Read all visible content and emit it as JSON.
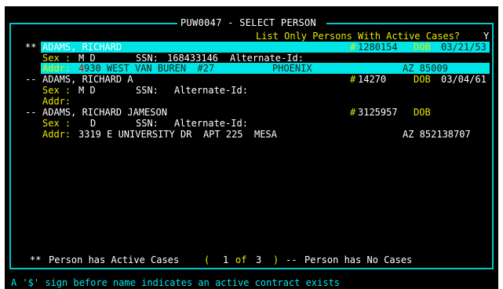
{
  "window": {
    "title": "PUW0047 - SELECT PERSON"
  },
  "filter": {
    "label": "List Only Persons With Active Cases?",
    "value": "Y"
  },
  "persons": [
    {
      "marker": "**",
      "name": "ADAMS, RICHARD",
      "id_prefix": "#",
      "id": "1280154",
      "dob_label": "DOB",
      "dob": "03/21/53",
      "sex_label": "Sex :",
      "sex": "M D",
      "ssn_label": "SSN:",
      "ssn": "168433146",
      "alt_id_label": "Alternate-Id:",
      "addr_label": "Addr:",
      "addr_mark": "4",
      "addr_street": "930 WEST VAN BUREN  #27",
      "addr_city": "PHOENIX",
      "addr_state_zip": "AZ 85009"
    },
    {
      "marker": "--",
      "name": "ADAMS, RICHARD A",
      "id_prefix": "#",
      "id": "14270",
      "dob_label": "DOB",
      "dob": "03/04/61",
      "sex_label": "Sex :",
      "sex": "M D",
      "ssn_label": "SSN:",
      "alt_id_label": "Alternate-Id:",
      "addr_label": "Addr:"
    },
    {
      "marker": "--",
      "name": "ADAMS, RICHARD JAMESON",
      "id_prefix": "#",
      "id": "3125957",
      "dob_label": "DOB",
      "sex_label": "Sex :",
      "sex": "D",
      "ssn_label": "SSN:",
      "alt_id_label": "Alternate-Id:",
      "addr_label": "Addr:",
      "addr_street": "3319 E UNIVERSITY DR  APT 225  MESA",
      "addr_state_zip": "AZ 852138707"
    }
  ],
  "legend": {
    "active_marker": "**",
    "active_text": "Person has Active Cases",
    "open_paren": "(",
    "page_current": "1",
    "page_of": "of",
    "page_total": "3",
    "close_paren": ")",
    "none_marker": "--",
    "none_text": "Person has No Cases"
  },
  "status": {
    "message": "A '$' sign before name indicates an active contract exists"
  },
  "colors": {
    "background": "#000000",
    "frame": "#00c8c8",
    "highlight": "#00e6e6",
    "label": "#e8e800",
    "text": "#ffffff",
    "active_mark": "#e80000"
  }
}
